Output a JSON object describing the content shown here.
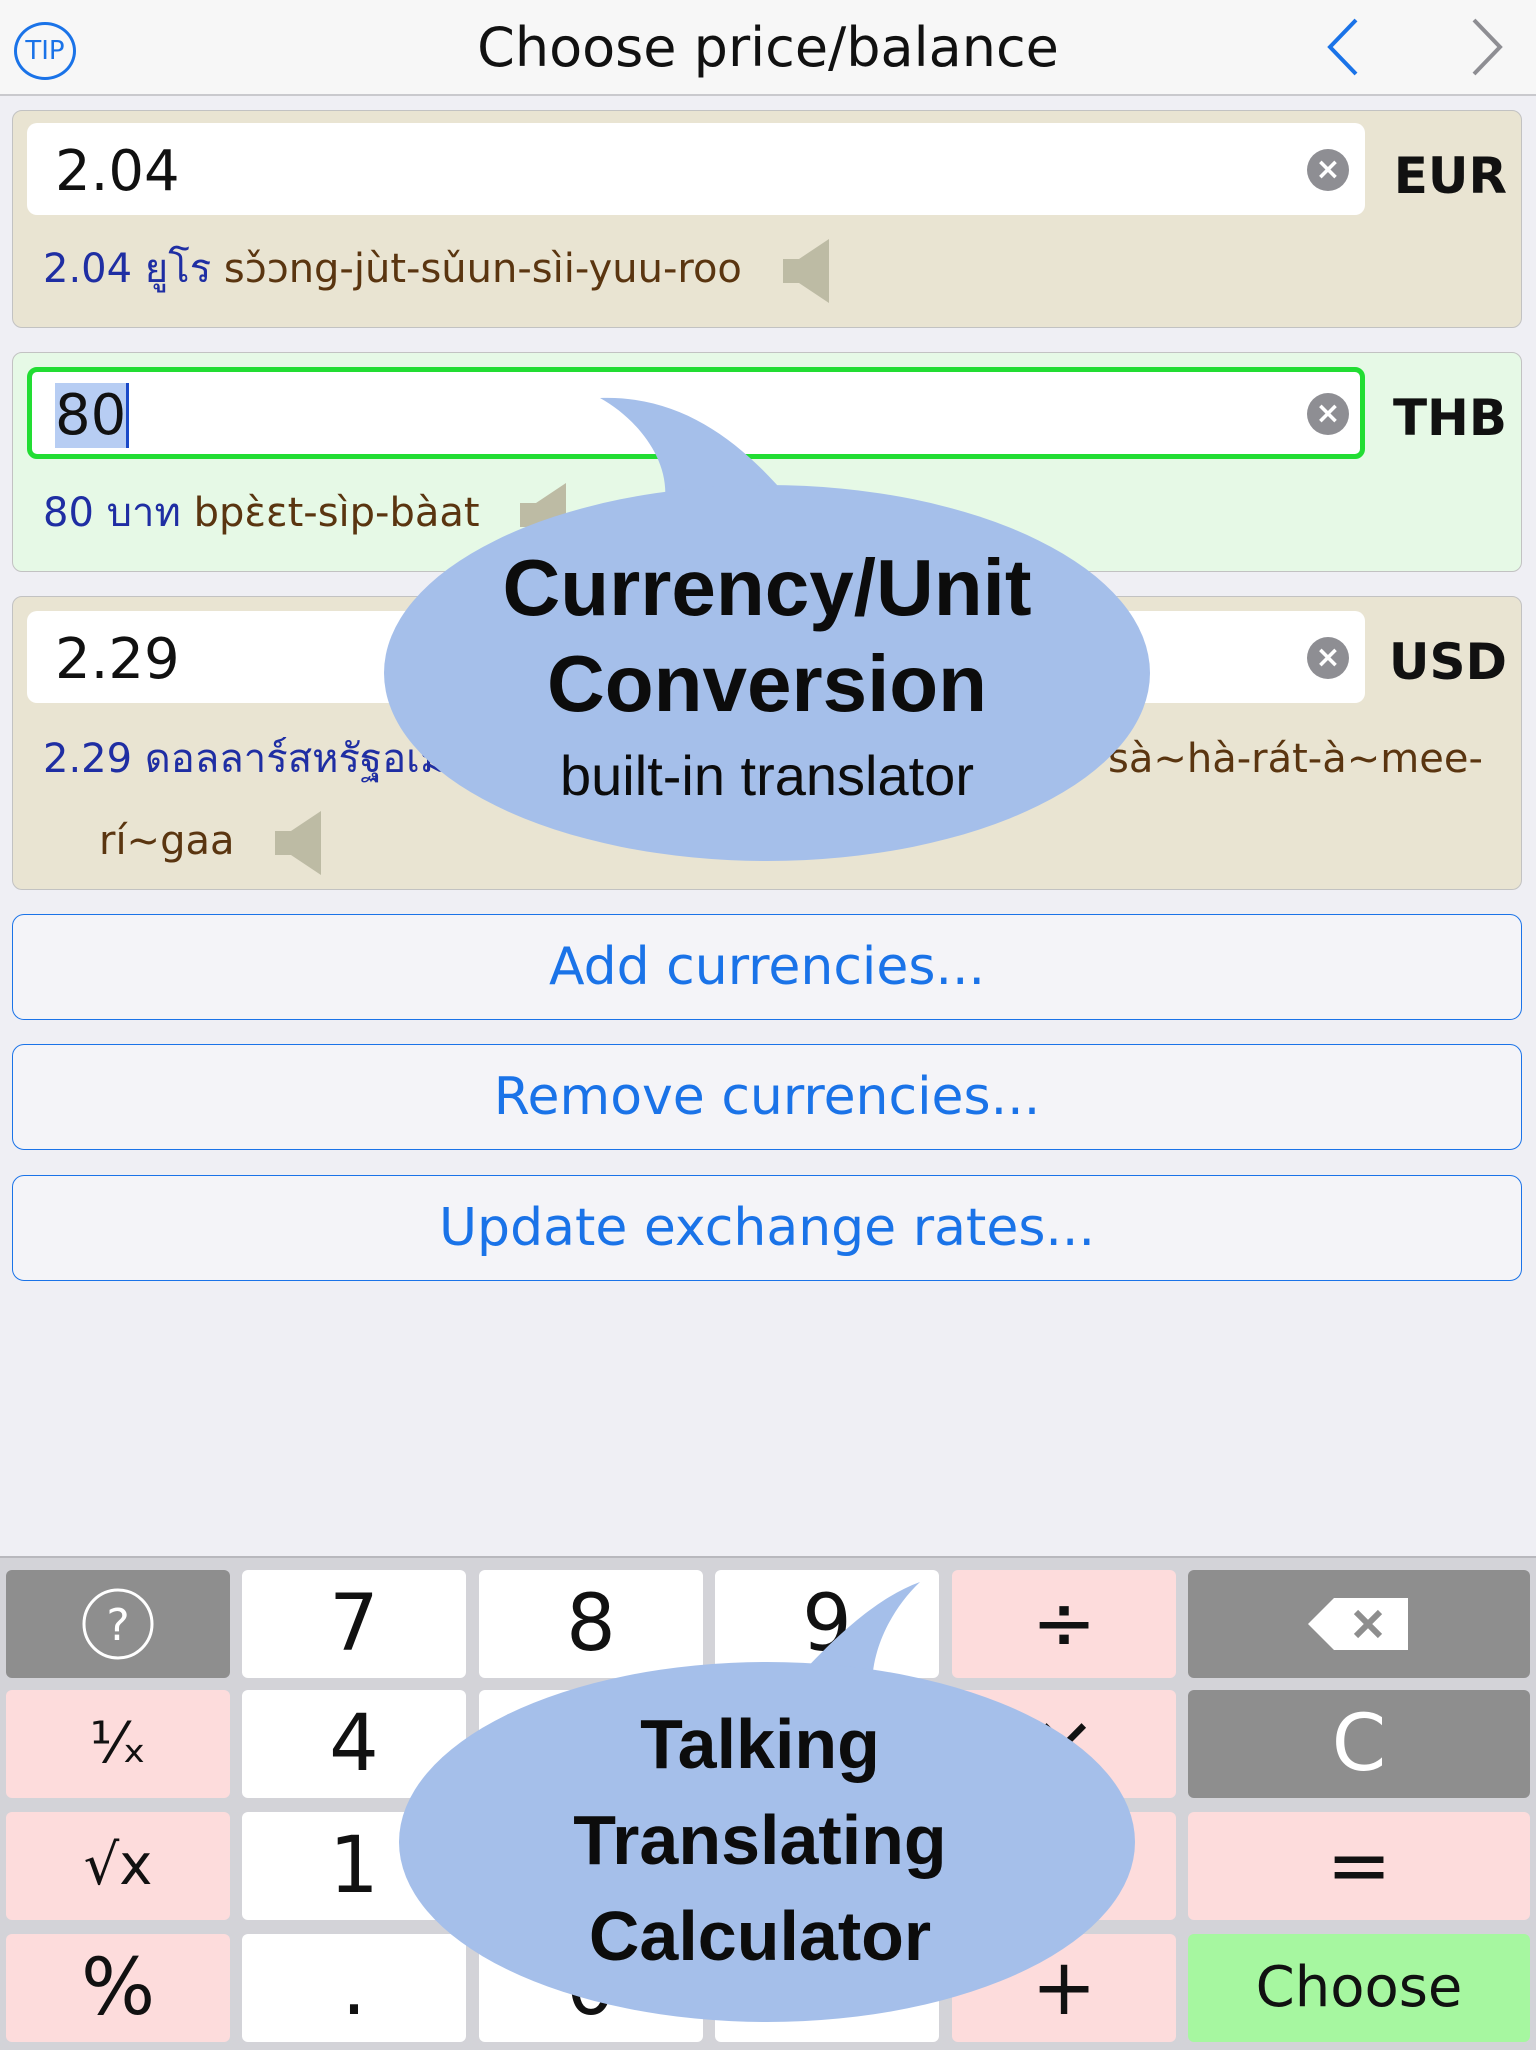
{
  "header": {
    "tip_label": "TIP",
    "title": "Choose price/balance"
  },
  "currencies": [
    {
      "value": "2.04",
      "code": "EUR",
      "translation_amount": "2.04 ยูโร",
      "translation_roman": "sɔ̌ɔng-jùt-sǔun-sìi-yuu-roo"
    },
    {
      "value": "80",
      "code": "THB",
      "translation_amount": "80 บาท",
      "translation_roman": "bpɛ̀ɛt-sìp-bàat"
    },
    {
      "value": "2.29",
      "code": "USD",
      "translation_amount": "2.29 ดอลลาร์สหรัฐอเม",
      "translation_roman_end": "sà~hà-rát-à~mee-",
      "translation_roman_line2": "rí~gaa"
    }
  ],
  "actions": {
    "add": "Add currencies...",
    "remove": "Remove currencies...",
    "update": "Update exchange rates..."
  },
  "callouts": {
    "top_line1": "Currency/Unit",
    "top_line2": "Conversion",
    "top_line3": "built-in translator",
    "bottom_line1": "Talking",
    "bottom_line2": "Translating",
    "bottom_line3": "Calculator"
  },
  "keypad": {
    "help": "?",
    "seven": "7",
    "eight": "8",
    "nine": "9",
    "divide": "÷",
    "reciprocal": "¹⁄ₓ",
    "four": "4",
    "multiply": "×",
    "clear": "C",
    "sqrt": "√x",
    "one": "1",
    "equals": "=",
    "percent": "%",
    "decimal": ".",
    "zero": "0",
    "plus": "+",
    "choose": "Choose"
  },
  "colors": {
    "accent": "#1a73e8",
    "active_border": "#22dd33",
    "bubble": "#a5bfea"
  }
}
